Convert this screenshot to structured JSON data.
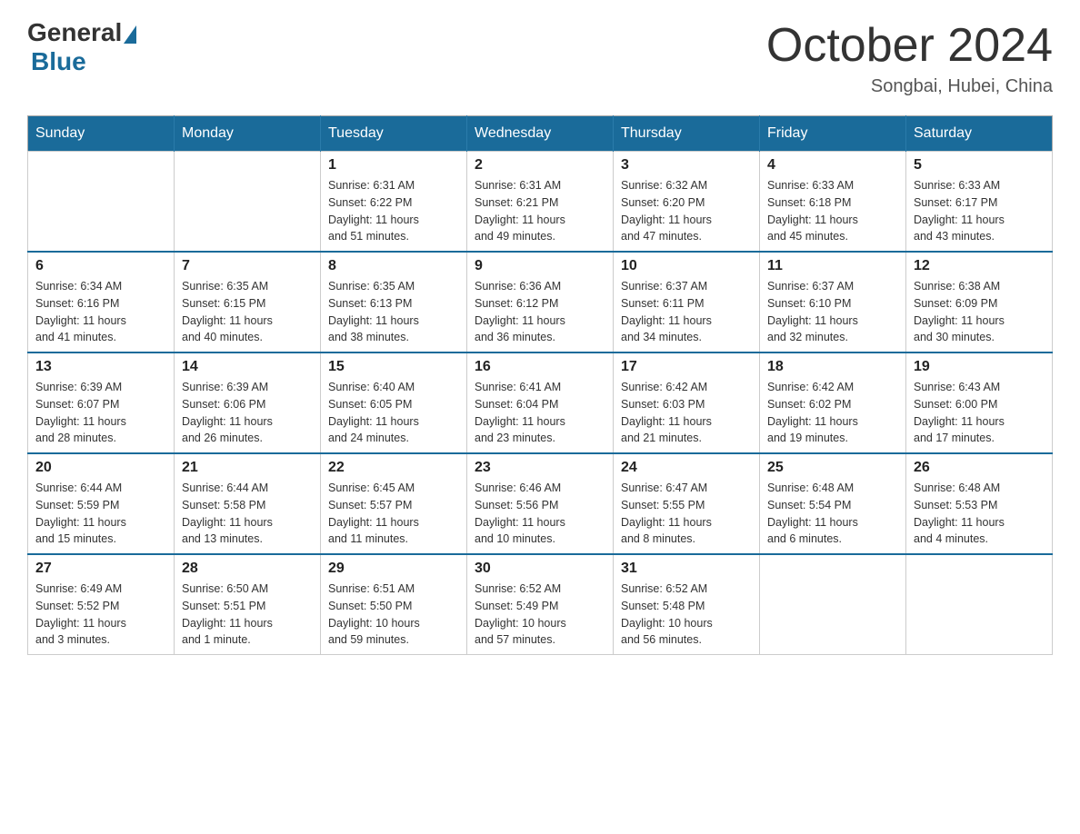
{
  "header": {
    "logo_general": "General",
    "logo_blue": "Blue",
    "month_title": "October 2024",
    "location": "Songbai, Hubei, China"
  },
  "days_of_week": [
    "Sunday",
    "Monday",
    "Tuesday",
    "Wednesday",
    "Thursday",
    "Friday",
    "Saturday"
  ],
  "weeks": [
    [
      {
        "day": "",
        "info": ""
      },
      {
        "day": "",
        "info": ""
      },
      {
        "day": "1",
        "info": "Sunrise: 6:31 AM\nSunset: 6:22 PM\nDaylight: 11 hours\nand 51 minutes."
      },
      {
        "day": "2",
        "info": "Sunrise: 6:31 AM\nSunset: 6:21 PM\nDaylight: 11 hours\nand 49 minutes."
      },
      {
        "day": "3",
        "info": "Sunrise: 6:32 AM\nSunset: 6:20 PM\nDaylight: 11 hours\nand 47 minutes."
      },
      {
        "day": "4",
        "info": "Sunrise: 6:33 AM\nSunset: 6:18 PM\nDaylight: 11 hours\nand 45 minutes."
      },
      {
        "day": "5",
        "info": "Sunrise: 6:33 AM\nSunset: 6:17 PM\nDaylight: 11 hours\nand 43 minutes."
      }
    ],
    [
      {
        "day": "6",
        "info": "Sunrise: 6:34 AM\nSunset: 6:16 PM\nDaylight: 11 hours\nand 41 minutes."
      },
      {
        "day": "7",
        "info": "Sunrise: 6:35 AM\nSunset: 6:15 PM\nDaylight: 11 hours\nand 40 minutes."
      },
      {
        "day": "8",
        "info": "Sunrise: 6:35 AM\nSunset: 6:13 PM\nDaylight: 11 hours\nand 38 minutes."
      },
      {
        "day": "9",
        "info": "Sunrise: 6:36 AM\nSunset: 6:12 PM\nDaylight: 11 hours\nand 36 minutes."
      },
      {
        "day": "10",
        "info": "Sunrise: 6:37 AM\nSunset: 6:11 PM\nDaylight: 11 hours\nand 34 minutes."
      },
      {
        "day": "11",
        "info": "Sunrise: 6:37 AM\nSunset: 6:10 PM\nDaylight: 11 hours\nand 32 minutes."
      },
      {
        "day": "12",
        "info": "Sunrise: 6:38 AM\nSunset: 6:09 PM\nDaylight: 11 hours\nand 30 minutes."
      }
    ],
    [
      {
        "day": "13",
        "info": "Sunrise: 6:39 AM\nSunset: 6:07 PM\nDaylight: 11 hours\nand 28 minutes."
      },
      {
        "day": "14",
        "info": "Sunrise: 6:39 AM\nSunset: 6:06 PM\nDaylight: 11 hours\nand 26 minutes."
      },
      {
        "day": "15",
        "info": "Sunrise: 6:40 AM\nSunset: 6:05 PM\nDaylight: 11 hours\nand 24 minutes."
      },
      {
        "day": "16",
        "info": "Sunrise: 6:41 AM\nSunset: 6:04 PM\nDaylight: 11 hours\nand 23 minutes."
      },
      {
        "day": "17",
        "info": "Sunrise: 6:42 AM\nSunset: 6:03 PM\nDaylight: 11 hours\nand 21 minutes."
      },
      {
        "day": "18",
        "info": "Sunrise: 6:42 AM\nSunset: 6:02 PM\nDaylight: 11 hours\nand 19 minutes."
      },
      {
        "day": "19",
        "info": "Sunrise: 6:43 AM\nSunset: 6:00 PM\nDaylight: 11 hours\nand 17 minutes."
      }
    ],
    [
      {
        "day": "20",
        "info": "Sunrise: 6:44 AM\nSunset: 5:59 PM\nDaylight: 11 hours\nand 15 minutes."
      },
      {
        "day": "21",
        "info": "Sunrise: 6:44 AM\nSunset: 5:58 PM\nDaylight: 11 hours\nand 13 minutes."
      },
      {
        "day": "22",
        "info": "Sunrise: 6:45 AM\nSunset: 5:57 PM\nDaylight: 11 hours\nand 11 minutes."
      },
      {
        "day": "23",
        "info": "Sunrise: 6:46 AM\nSunset: 5:56 PM\nDaylight: 11 hours\nand 10 minutes."
      },
      {
        "day": "24",
        "info": "Sunrise: 6:47 AM\nSunset: 5:55 PM\nDaylight: 11 hours\nand 8 minutes."
      },
      {
        "day": "25",
        "info": "Sunrise: 6:48 AM\nSunset: 5:54 PM\nDaylight: 11 hours\nand 6 minutes."
      },
      {
        "day": "26",
        "info": "Sunrise: 6:48 AM\nSunset: 5:53 PM\nDaylight: 11 hours\nand 4 minutes."
      }
    ],
    [
      {
        "day": "27",
        "info": "Sunrise: 6:49 AM\nSunset: 5:52 PM\nDaylight: 11 hours\nand 3 minutes."
      },
      {
        "day": "28",
        "info": "Sunrise: 6:50 AM\nSunset: 5:51 PM\nDaylight: 11 hours\nand 1 minute."
      },
      {
        "day": "29",
        "info": "Sunrise: 6:51 AM\nSunset: 5:50 PM\nDaylight: 10 hours\nand 59 minutes."
      },
      {
        "day": "30",
        "info": "Sunrise: 6:52 AM\nSunset: 5:49 PM\nDaylight: 10 hours\nand 57 minutes."
      },
      {
        "day": "31",
        "info": "Sunrise: 6:52 AM\nSunset: 5:48 PM\nDaylight: 10 hours\nand 56 minutes."
      },
      {
        "day": "",
        "info": ""
      },
      {
        "day": "",
        "info": ""
      }
    ]
  ]
}
